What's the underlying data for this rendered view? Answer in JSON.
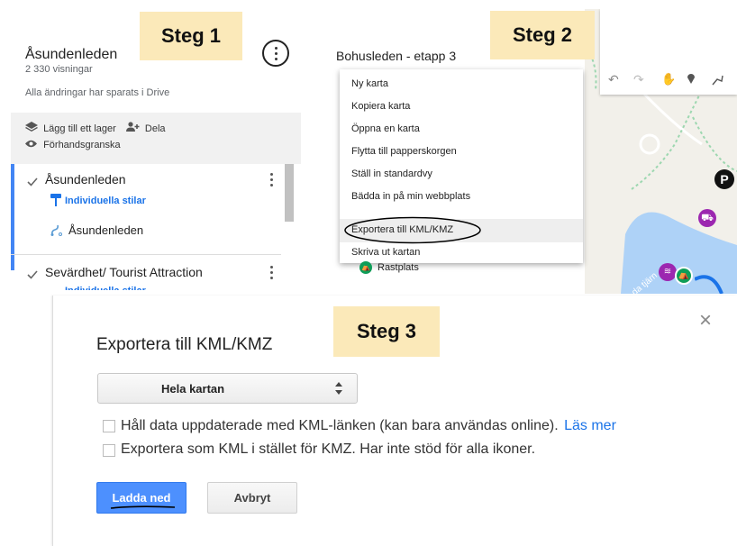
{
  "panel1": {
    "map_title": "Åsundenleden",
    "views": "2 330 visningar",
    "saved_status": "Alla ändringar har sparats i Drive",
    "add_layer": "Lägg till ett lager",
    "share": "Dela",
    "preview": "Förhandsgranska",
    "layers": [
      {
        "name": "Åsundenleden",
        "style": "Individuella stilar",
        "item": "Åsundenleden"
      },
      {
        "name": "Sevärdhet/ Tourist Attraction",
        "style": "Individuella stilar"
      }
    ]
  },
  "panel2": {
    "map_title": "Bohusleden - etapp 3",
    "menu_items": [
      "Ny karta",
      "Kopiera karta",
      "Öppna en karta",
      "Flytta till papperskorgen",
      "Ställ in standardvy",
      "Bädda in på min webbplats",
      "Exportera till KML/KMZ",
      "Skriva ut kartan"
    ],
    "layer_item": "Rastplats",
    "map_label": "da tjärn",
    "marker_p": "P"
  },
  "panel3": {
    "dialog_title": "Exportera till KML/KMZ",
    "select_value": "Hela kartan",
    "checkbox1_label": "Håll data uppdaterade med KML-länken (kan bara användas online).",
    "learn_more": "Läs mer",
    "checkbox2_label": "Exportera som KML i stället för KMZ. Har inte stöd för alla ikoner.",
    "download_button": "Ladda ned",
    "cancel_button": "Avbryt",
    "close_symbol": "×"
  },
  "step_labels": {
    "step1": "Steg 1",
    "step2": "Steg 2",
    "step3": "Steg 3"
  },
  "colors": {
    "accent": "#4285f4",
    "step_bg": "#fbe9b9",
    "link": "#1a73e8",
    "map_water": "#aed2f7",
    "map_land": "#f2f0ea",
    "marker_purple": "#9c27b0",
    "marker_green": "#0f9d58"
  }
}
